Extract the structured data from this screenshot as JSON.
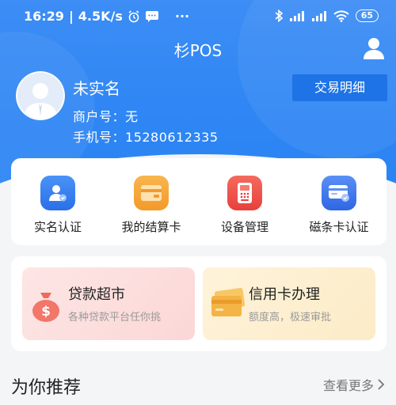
{
  "status_bar": {
    "time": "16:29",
    "speed": "4.5K/s",
    "dots": "···",
    "battery": "65",
    "icons": [
      "alarm-icon",
      "message-icon",
      "bluetooth-icon",
      "signal-icon",
      "wifi-icon",
      "battery-icon"
    ]
  },
  "header": {
    "title": "杉POS"
  },
  "profile": {
    "name": "未实名",
    "merchant_label": "商户号：",
    "merchant_value": "无",
    "phone_label": "手机号：",
    "phone_value": "15280612335",
    "trade_button": "交易明细"
  },
  "features": [
    {
      "label": "实名认证",
      "icon": "id-verify-icon",
      "color": "#2f7cf0"
    },
    {
      "label": "我的结算卡",
      "icon": "settlement-card-icon",
      "color": "#f6a43a"
    },
    {
      "label": "设备管理",
      "icon": "pos-device-icon",
      "color": "#ef4b4b"
    },
    {
      "label": "磁条卡认证",
      "icon": "magstripe-card-icon",
      "color": "#3b79ee"
    }
  ],
  "promos": [
    {
      "title": "贷款超市",
      "subtitle": "各种贷款平台任你挑",
      "icon": "money-bag-icon",
      "bg": "#fde3e2"
    },
    {
      "title": "信用卡办理",
      "subtitle": "额度高，极速审批",
      "icon": "credit-card-icon",
      "bg": "#fdf1d6"
    }
  ],
  "recommend": {
    "title": "为你推荐",
    "more": "查看更多"
  }
}
